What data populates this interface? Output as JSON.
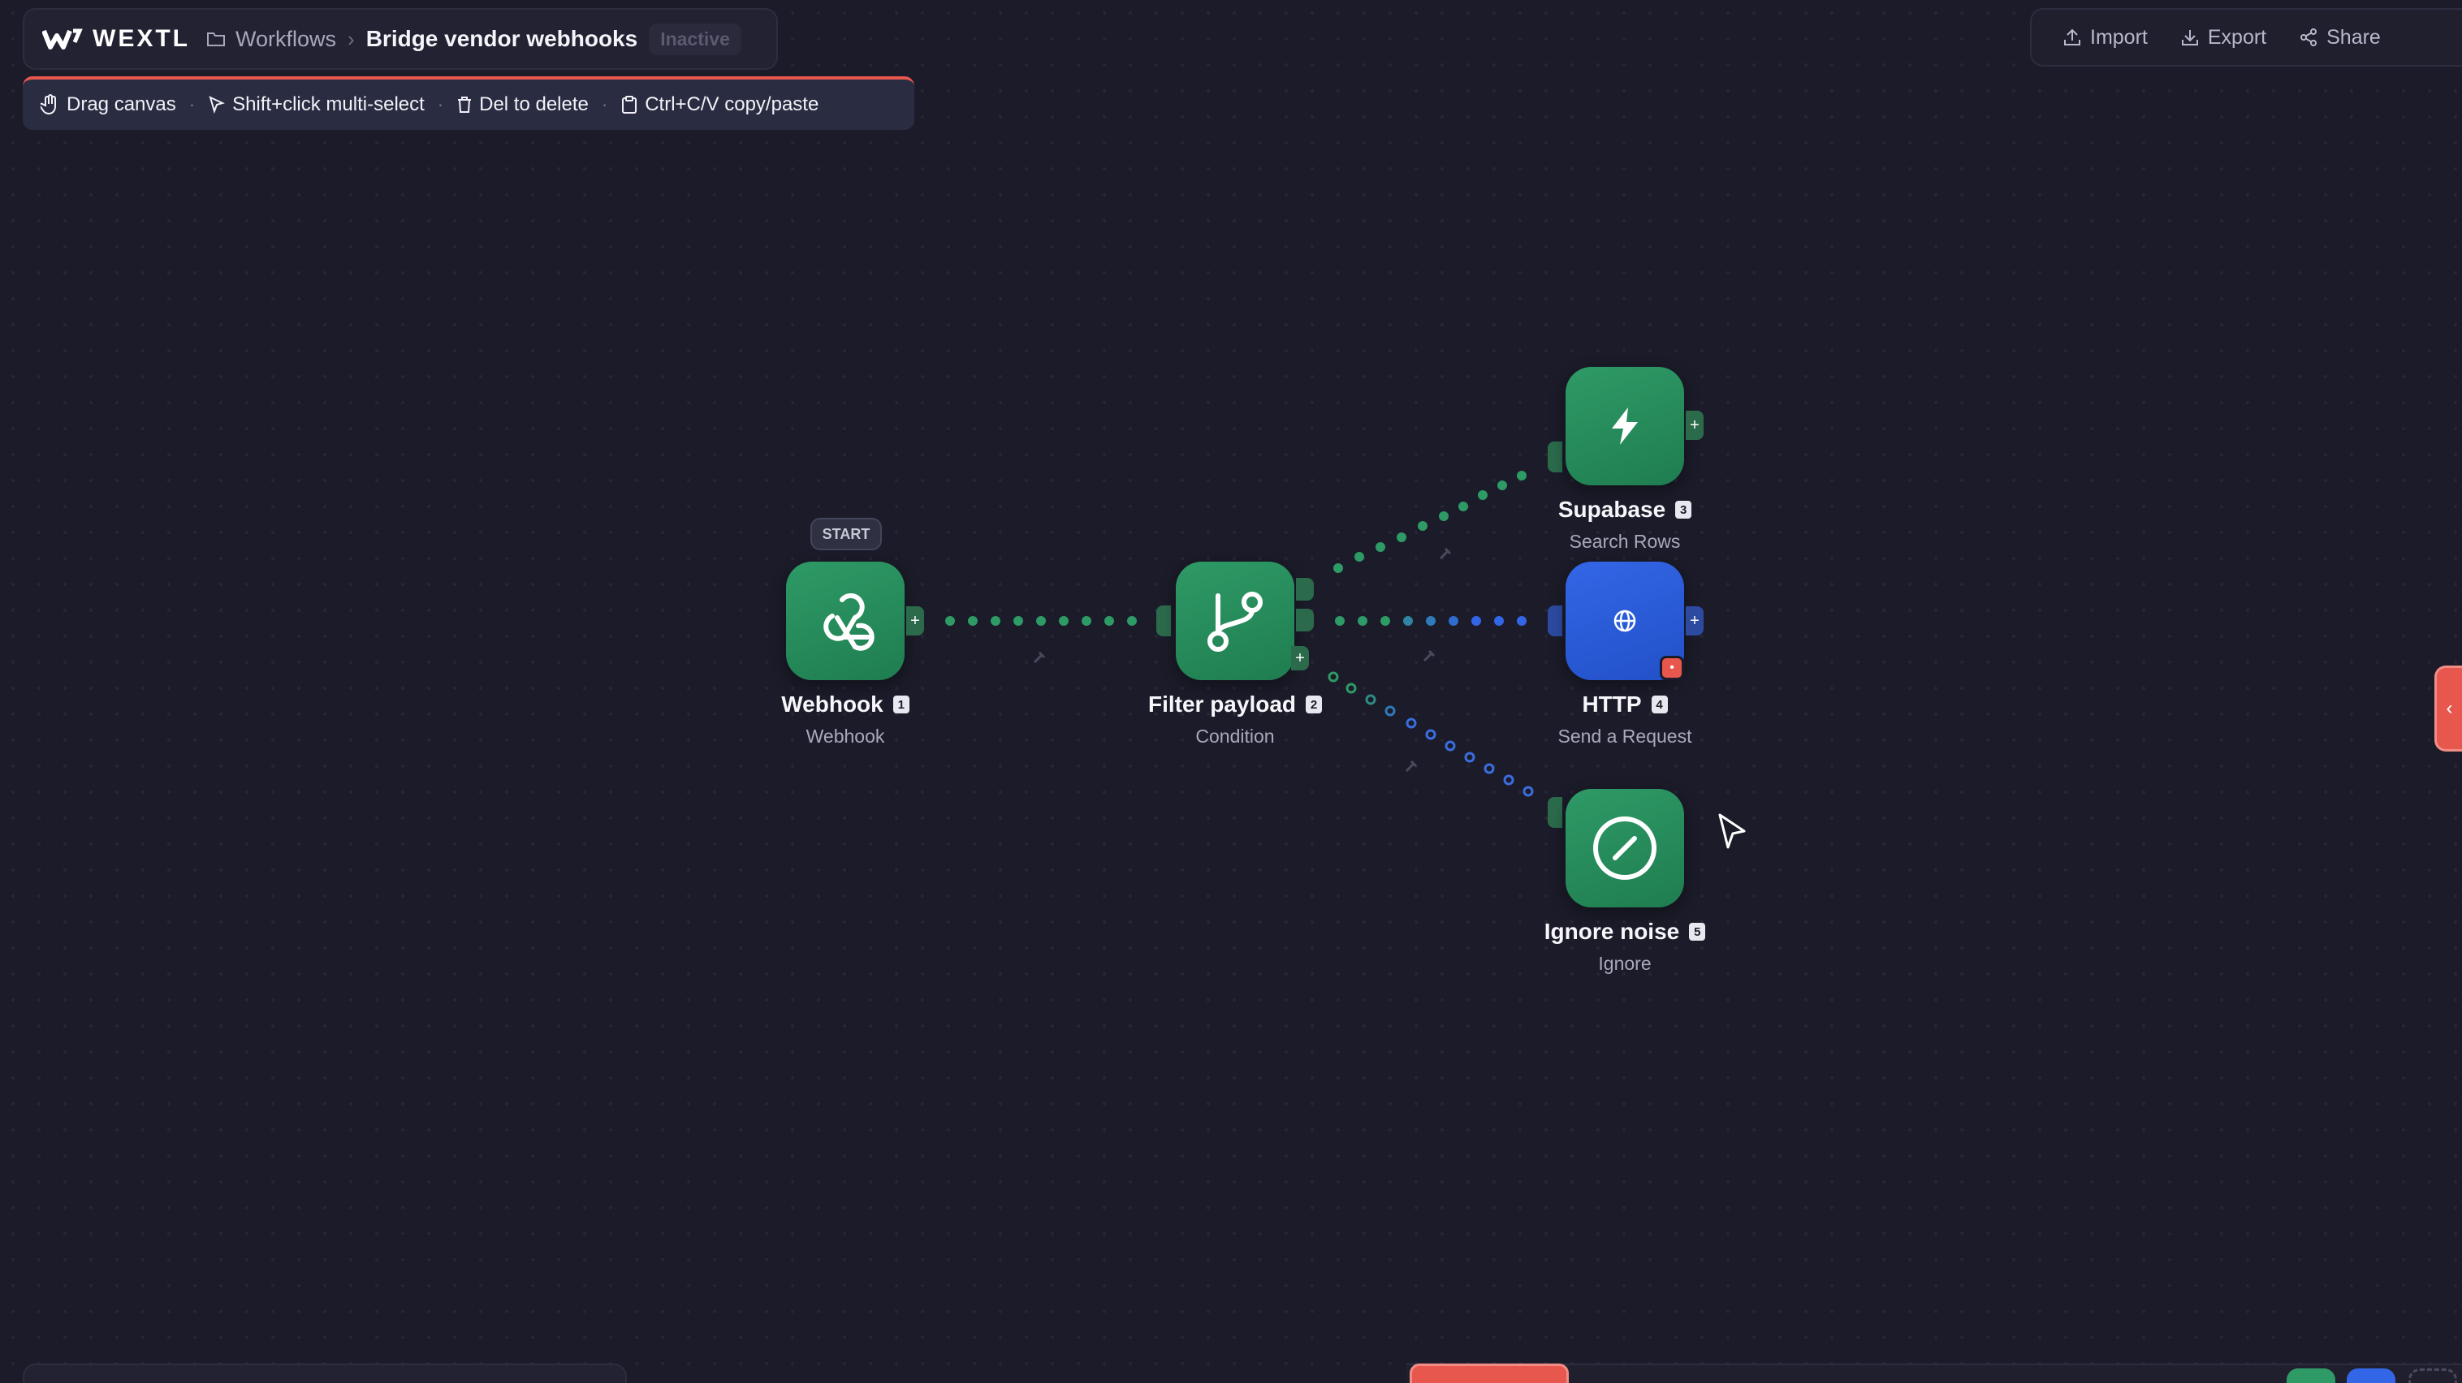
{
  "app": {
    "logo_text": "WEXTL",
    "breadcrumb": {
      "root": "Workflows",
      "title": "Bridge vendor webhooks",
      "status": "Inactive"
    }
  },
  "hints": [
    {
      "label": "Drag canvas",
      "icon": "hand-icon"
    },
    {
      "label": "Shift+click multi-select",
      "icon": "pointer-icon"
    },
    {
      "label": "Del to delete",
      "icon": "trash-icon"
    },
    {
      "label": "Ctrl+C/V copy/paste",
      "icon": "clipboard-icon"
    }
  ],
  "toolbar": {
    "import": "Import",
    "export": "Export",
    "share": "Share"
  },
  "start_badge": "START",
  "nodes": {
    "webhook": {
      "title": "Webhook",
      "index": "1",
      "subtitle": "Webhook",
      "icon": "webhook-icon",
      "color": "#2e9a66"
    },
    "filter": {
      "title": "Filter payload",
      "index": "2",
      "subtitle": "Condition",
      "icon": "branch-icon",
      "color": "#2e9a66"
    },
    "supabase": {
      "title": "Supabase",
      "index": "3",
      "subtitle": "Search Rows",
      "icon": "bolt-icon",
      "color": "#2e9a66"
    },
    "http": {
      "title": "HTTP",
      "index": "4",
      "subtitle": "Send a Request",
      "icon": "globe-icon",
      "color": "#3366e6",
      "has_error": true
    },
    "ignore": {
      "title": "Ignore noise",
      "index": "5",
      "subtitle": "Ignore",
      "icon": "ban-icon",
      "color": "#2e9a66"
    }
  },
  "colors": {
    "accent_red": "#e8574e",
    "green": "#2e9a66",
    "blue": "#3366e6"
  }
}
